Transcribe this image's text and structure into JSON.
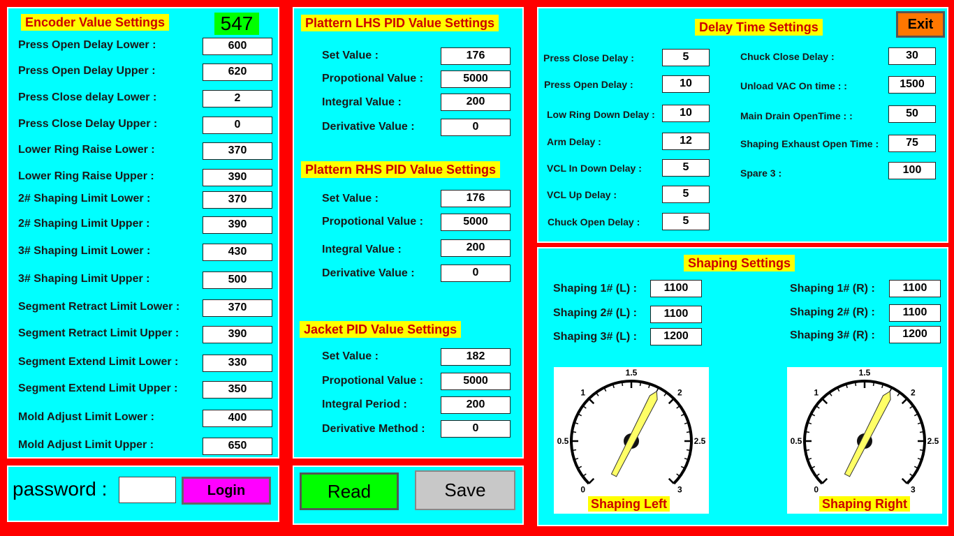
{
  "encoder": {
    "title": "Encoder Value Settings",
    "current_value": "547",
    "items": [
      {
        "label": "Press Open Delay Lower :",
        "value": "600"
      },
      {
        "label": "Press Open Delay Upper :",
        "value": "620"
      },
      {
        "label": "Press Close delay Lower :",
        "value": "2"
      },
      {
        "label": "Press Close Delay Upper :",
        "value": "0"
      },
      {
        "label": "Lower Ring Raise Lower :",
        "value": "370"
      },
      {
        "label": "Lower Ring Raise Upper :",
        "value": "390"
      },
      {
        "label": "2# Shaping Limit Lower :",
        "value": "370"
      },
      {
        "label": "2# Shaping  Limit Upper :",
        "value": "390"
      },
      {
        "label": "3# Shaping Limit Lower :",
        "value": "430"
      },
      {
        "label": "3# Shaping Limit Upper :",
        "value": "500"
      },
      {
        "label": "Segment Retract Limit Lower :",
        "value": "370"
      },
      {
        "label": "Segment Retract Limit Upper :",
        "value": "390"
      },
      {
        "label": "Segment Extend Limit Lower :",
        "value": "330"
      },
      {
        "label": "Segment Extend Limit Upper :",
        "value": "350"
      },
      {
        "label": "Mold Adjust Limit Lower :",
        "value": "400"
      },
      {
        "label": "Mold Adjust Limit Upper :",
        "value": "650"
      }
    ]
  },
  "login": {
    "password_label": "password :",
    "password_value": "",
    "login_button": "Login"
  },
  "pid_lhs": {
    "title": "Plattern LHS  PID Value Settings",
    "items": [
      {
        "label": "Set Value   :",
        "value": "176"
      },
      {
        "label": "Propotional Value  :",
        "value": "5000"
      },
      {
        "label": "Integral Value   :",
        "value": "200"
      },
      {
        "label": "Derivative Value   :",
        "value": "0"
      }
    ]
  },
  "pid_rhs": {
    "title": "Plattern RHS PID Value Settings",
    "items": [
      {
        "label": "Set Value   :",
        "value": "176"
      },
      {
        "label": "Propotional Value  :",
        "value": "5000"
      },
      {
        "label": "Integral Value   :",
        "value": "200"
      },
      {
        "label": "Derivative Value   :",
        "value": "0"
      }
    ]
  },
  "pid_jacket": {
    "title": "Jacket PID Value Settings",
    "items": [
      {
        "label": "Set Value   :",
        "value": "182"
      },
      {
        "label": "Propotional Value  :",
        "value": "5000"
      },
      {
        "label": "Integral Period   :",
        "value": "200"
      },
      {
        "label": "Derivative Method   :",
        "value": "0"
      }
    ]
  },
  "actions": {
    "read_button": "Read",
    "save_button": "Save"
  },
  "delay": {
    "title": "Delay Time Settings",
    "exit_button": "Exit",
    "left": [
      {
        "label": "Press Close Delay :",
        "value": "5"
      },
      {
        "label": "Press Open Delay :",
        "value": "10"
      },
      {
        "label": "Low Ring Down Delay :",
        "value": "10"
      },
      {
        "label": "Arm Delay :",
        "value": "12"
      },
      {
        "label": "VCL In Down Delay :",
        "value": "5"
      },
      {
        "label": "VCL Up Delay :",
        "value": "5"
      },
      {
        "label": "Chuck Open Delay :",
        "value": "5"
      }
    ],
    "right": [
      {
        "label": "Chuck Close Delay :",
        "value": "30"
      },
      {
        "label": "Unload VAC On time :  :",
        "value": "1500"
      },
      {
        "label": "Main Drain OpenTime :  :",
        "value": "50"
      },
      {
        "label": "Shaping Exhaust Open Time :",
        "value": "75"
      },
      {
        "label": "Spare 3 :",
        "value": "100"
      }
    ]
  },
  "shaping": {
    "title": "Shaping Settings",
    "left": [
      {
        "label": "Shaping 1# (L) :",
        "value": "1100"
      },
      {
        "label": "Shaping 2# (L) :",
        "value": "1100"
      },
      {
        "label": "Shaping 3# (L) :",
        "value": "1200"
      }
    ],
    "right": [
      {
        "label": "Shaping 1# (R) :",
        "value": "1100"
      },
      {
        "label": "Shaping 2# (R) :",
        "value": "1100"
      },
      {
        "label": "Shaping 3# (R) :",
        "value": "1200"
      }
    ],
    "gauges": [
      {
        "label": "Shaping Left",
        "value": 1.8,
        "ticks": [
          "0",
          "0.5",
          "1",
          "1.5",
          "2",
          "2.5",
          "3"
        ]
      },
      {
        "label": "Shaping Right",
        "value": 1.8,
        "ticks": [
          "0",
          "0.5",
          "1",
          "1.5",
          "2",
          "2.5",
          "3"
        ]
      }
    ]
  },
  "colors": {
    "background": "#ff0000",
    "panel": "#00ffff",
    "title_bg": "#ffff00",
    "title_text": "#cc0000",
    "current_value_bg": "#00ff00",
    "login_bg": "#ff00ff",
    "read_bg": "#00ff00",
    "save_bg": "#c8c8c8",
    "exit_bg": "#ff7700",
    "needle": "#ffff66"
  }
}
